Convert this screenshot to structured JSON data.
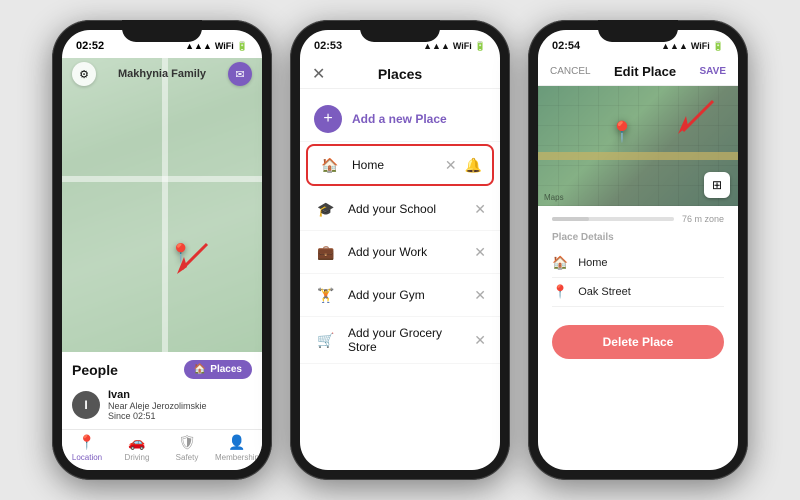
{
  "phone1": {
    "status": {
      "time": "02:52",
      "icons": [
        "▲",
        "WiFi",
        "🔋"
      ]
    },
    "header": {
      "title": "Makhynia Family",
      "settings_label": "⚙",
      "message_label": "✉"
    },
    "map": {
      "pin_emoji": "📍"
    },
    "bottom": {
      "people_label": "People",
      "places_btn": "Places",
      "user_name": "Ivan",
      "user_sub1": "Near Aleje Jerozolimskie",
      "user_sub2": "Since 02:51",
      "avatar_initial": "I"
    },
    "nav": {
      "items": [
        {
          "label": "Location",
          "icon": "📍",
          "active": true
        },
        {
          "label": "Driving",
          "icon": "🚗",
          "active": false
        },
        {
          "label": "Safety",
          "icon": "🛡",
          "active": false
        },
        {
          "label": "Membership",
          "icon": "👤",
          "active": false
        }
      ]
    }
  },
  "phone2": {
    "status": {
      "time": "02:53"
    },
    "header": {
      "title": "Places",
      "close_label": "✕"
    },
    "add_place": {
      "label": "Add a new Place",
      "icon": "+"
    },
    "places": [
      {
        "icon": "🏠",
        "label": "Home",
        "highlighted": true
      },
      {
        "icon": "🎓",
        "label": "Add your School",
        "highlighted": false
      },
      {
        "icon": "💼",
        "label": "Add your Work",
        "highlighted": false
      },
      {
        "icon": "🏋",
        "label": "Add your Gym",
        "highlighted": false
      },
      {
        "icon": "🛒",
        "label": "Add your Grocery Store",
        "highlighted": false
      }
    ]
  },
  "phone3": {
    "status": {
      "time": "02:54"
    },
    "header": {
      "cancel_label": "CANCEL",
      "title": "Edit Place",
      "save_label": "SAVE"
    },
    "map": {
      "credit": "Maps",
      "layers_icon": "⊞"
    },
    "radius": {
      "label": "76 m zone"
    },
    "details_section": {
      "title": "Place details",
      "rows": [
        {
          "icon": "🏠",
          "text": "Home"
        },
        {
          "icon": "📍",
          "text": "Oak Street"
        }
      ]
    },
    "delete_btn": "Delete Place"
  }
}
